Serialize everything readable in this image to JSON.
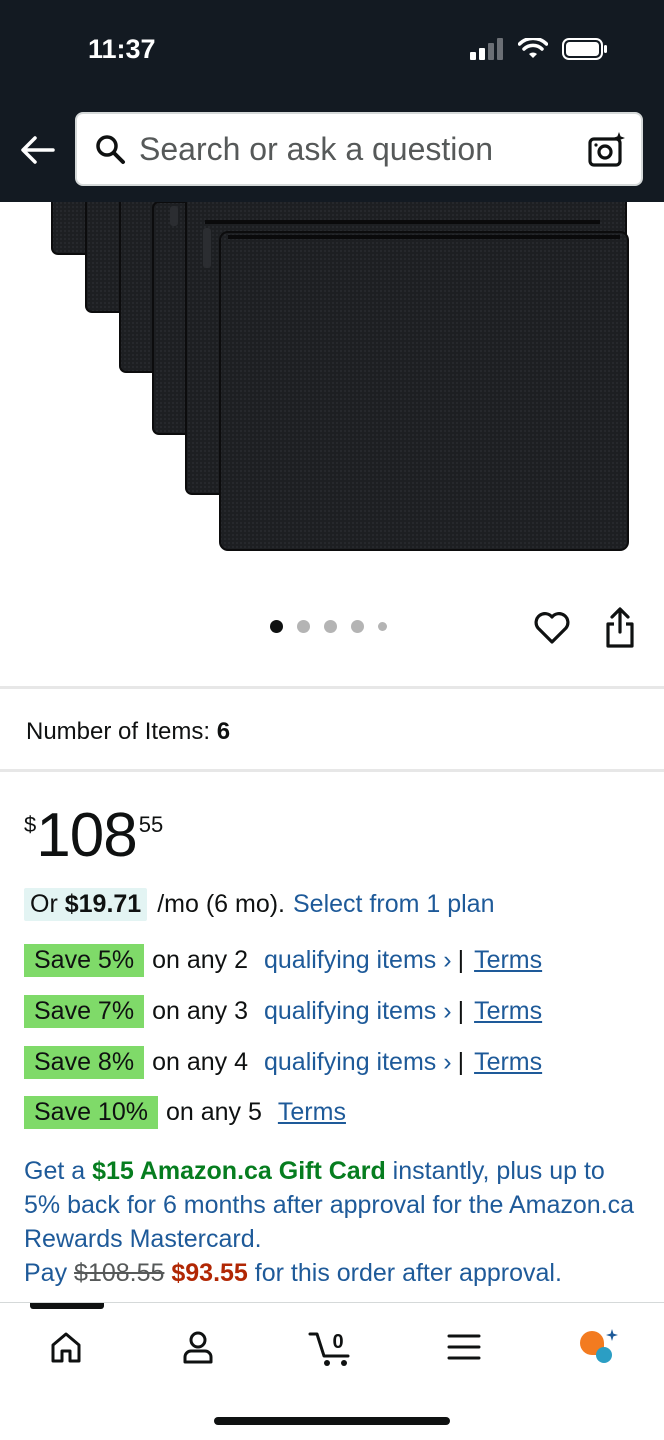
{
  "status_bar": {
    "time": "11:37"
  },
  "header": {
    "search_placeholder": "Search or ask a question"
  },
  "gallery": {
    "image_count": 5,
    "active_index": 0
  },
  "variant": {
    "label": "Number of Items:",
    "value": "6"
  },
  "price": {
    "symbol": "$",
    "whole": "108",
    "fraction": "55"
  },
  "installment": {
    "prefix": "Or",
    "amount": "$19.71",
    "term": "/mo (6 mo).",
    "plan_link": "Select from 1 plan"
  },
  "promotions": [
    {
      "badge": "Save 5%",
      "text": "on any 2",
      "link": "qualifying items ›",
      "sep": "|",
      "terms": "Terms"
    },
    {
      "badge": "Save 7%",
      "text": "on any 3",
      "link": "qualifying items ›",
      "sep": "|",
      "terms": "Terms"
    },
    {
      "badge": "Save 8%",
      "text": "on any 4",
      "link": "qualifying items ›",
      "sep": "|",
      "terms": "Terms"
    },
    {
      "badge": "Save 10%",
      "text": "on any 5",
      "terms": "Terms"
    }
  ],
  "card_offer": {
    "part1": "Get a",
    "gift": "$15 Amazon.ca Gift Card",
    "part2": "instantly, plus up to 5% back for 6 months after approval for the Amazon.ca Rewards Mastercard.",
    "pay": "Pay",
    "old_price": "$108.55",
    "new_price": "$93.55",
    "part3": "for this order after approval."
  },
  "bottom_nav": {
    "items": [
      "home-icon",
      "account-icon",
      "cart-icon",
      "menu-icon",
      "rufus-assistant-icon"
    ],
    "cart_count": "0"
  },
  "colors": {
    "header_bg": "#131a22",
    "link": "#1e5a99",
    "promo_badge": "#7fda69",
    "gift_green": "#067d1f",
    "sale_red": "#b12704",
    "installment_badge": "#e3f4f3"
  }
}
